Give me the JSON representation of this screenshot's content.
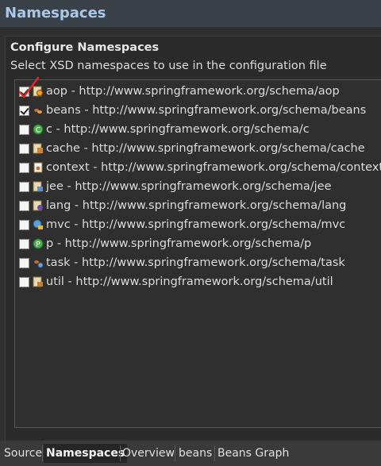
{
  "window": {
    "title": "Namespaces"
  },
  "section": {
    "title": "Configure Namespaces",
    "description": "Select XSD namespaces to use in the configuration file"
  },
  "namespaces": [
    {
      "label": "aop - http://www.springframework.org/schema/aop",
      "checked": true,
      "icon": "aop-namespace-icon"
    },
    {
      "label": "beans - http://www.springframework.org/schema/beans",
      "checked": true,
      "icon": "beans-namespace-icon"
    },
    {
      "label": "c - http://www.springframework.org/schema/c",
      "checked": false,
      "icon": "c-namespace-icon"
    },
    {
      "label": "cache - http://www.springframework.org/schema/cache",
      "checked": false,
      "icon": "cache-namespace-icon"
    },
    {
      "label": "context - http://www.springframework.org/schema/context",
      "checked": false,
      "icon": "context-namespace-icon"
    },
    {
      "label": "jee - http://www.springframework.org/schema/jee",
      "checked": false,
      "icon": "jee-namespace-icon"
    },
    {
      "label": "lang - http://www.springframework.org/schema/lang",
      "checked": false,
      "icon": "lang-namespace-icon"
    },
    {
      "label": "mvc - http://www.springframework.org/schema/mvc",
      "checked": false,
      "icon": "mvc-namespace-icon"
    },
    {
      "label": "p - http://www.springframework.org/schema/p",
      "checked": false,
      "icon": "p-namespace-icon"
    },
    {
      "label": "task - http://www.springframework.org/schema/task",
      "checked": false,
      "icon": "task-namespace-icon"
    },
    {
      "label": "util - http://www.springframework.org/schema/util",
      "checked": false,
      "icon": "util-namespace-icon"
    }
  ],
  "tabs": [
    {
      "label": "Source",
      "active": false
    },
    {
      "label": "Namespaces",
      "active": true
    },
    {
      "label": "Overview",
      "active": false
    },
    {
      "label": "beans",
      "active": false
    },
    {
      "label": "Beans Graph",
      "active": false
    }
  ],
  "colors": {
    "accent_annotation": "#e0262a",
    "title_text": "#a9c7e6",
    "background": "#2f2f2f"
  }
}
